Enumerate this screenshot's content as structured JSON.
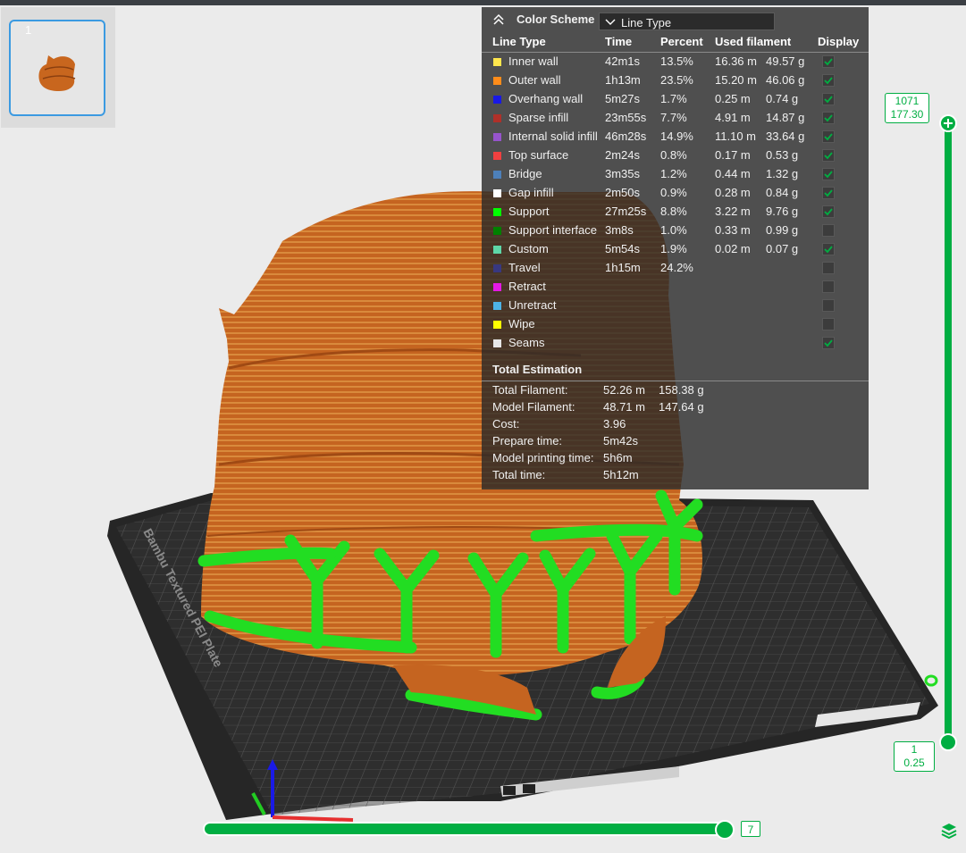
{
  "plate": {
    "number": "1"
  },
  "legend": {
    "collapse_icon": "chevron-up-double-icon",
    "title": "Color Scheme",
    "scheme_value": "Line Type",
    "columns": [
      "Line Type",
      "Time",
      "Percent",
      "Used filament",
      "Display"
    ],
    "rows": [
      {
        "name": "Inner wall",
        "color": "#ffe64d",
        "time": "42m1s",
        "percent": "13.5%",
        "meters": "16.36 m",
        "grams": "49.57 g",
        "display": true
      },
      {
        "name": "Outer wall",
        "color": "#ff8c1a",
        "time": "1h13m",
        "percent": "23.5%",
        "meters": "15.20 m",
        "grams": "46.06 g",
        "display": true
      },
      {
        "name": "Overhang wall",
        "color": "#1919e6",
        "time": "5m27s",
        "percent": "1.7%",
        "meters": "0.25 m",
        "grams": "0.74 g",
        "display": true
      },
      {
        "name": "Sparse infill",
        "color": "#b03029",
        "time": "23m55s",
        "percent": "7.7%",
        "meters": "4.91 m",
        "grams": "14.87 g",
        "display": true
      },
      {
        "name": "Internal solid infill",
        "color": "#9654cc",
        "time": "46m28s",
        "percent": "14.9%",
        "meters": "11.10 m",
        "grams": "33.64 g",
        "display": true
      },
      {
        "name": "Top surface",
        "color": "#f04040",
        "time": "2m24s",
        "percent": "0.8%",
        "meters": "0.17 m",
        "grams": "0.53 g",
        "display": true
      },
      {
        "name": "Bridge",
        "color": "#4d80ba",
        "time": "3m35s",
        "percent": "1.2%",
        "meters": "0.44 m",
        "grams": "1.32 g",
        "display": true
      },
      {
        "name": "Gap infill",
        "color": "#ffffff",
        "time": "2m50s",
        "percent": "0.9%",
        "meters": "0.28 m",
        "grams": "0.84 g",
        "display": true
      },
      {
        "name": "Support",
        "color": "#00ff00",
        "time": "27m25s",
        "percent": "8.8%",
        "meters": "3.22 m",
        "grams": "9.76 g",
        "display": true
      },
      {
        "name": "Support interface",
        "color": "#008000",
        "time": "3m8s",
        "percent": "1.0%",
        "meters": "0.33 m",
        "grams": "0.99 g",
        "display": false
      },
      {
        "name": "Custom",
        "color": "#5ed7a8",
        "time": "5m54s",
        "percent": "1.9%",
        "meters": "0.02 m",
        "grams": "0.07 g",
        "display": true
      },
      {
        "name": "Travel",
        "color": "#383880",
        "time": "1h15m",
        "percent": "24.2%",
        "meters": "",
        "grams": "",
        "display": false
      },
      {
        "name": "Retract",
        "color": "#e619e6",
        "time": "",
        "percent": "",
        "meters": "",
        "grams": "",
        "display": false
      },
      {
        "name": "Unretract",
        "color": "#4db3e6",
        "time": "",
        "percent": "",
        "meters": "",
        "grams": "",
        "display": false
      },
      {
        "name": "Wipe",
        "color": "#ffff00",
        "time": "",
        "percent": "",
        "meters": "",
        "grams": "",
        "display": false
      },
      {
        "name": "Seams",
        "color": "#e6e6e6",
        "time": "",
        "percent": "",
        "meters": "",
        "grams": "",
        "display": true
      }
    ],
    "total_title": "Total Estimation",
    "totals": [
      {
        "label": "Total Filament:",
        "v1": "52.26 m",
        "v2": "158.38 g"
      },
      {
        "label": "Model Filament:",
        "v1": "48.71 m",
        "v2": "147.64 g"
      },
      {
        "label": "Cost:",
        "v1": "3.96",
        "v2": ""
      },
      {
        "label": "Prepare time:",
        "v1": "5m42s",
        "v2": ""
      },
      {
        "label": "Model printing time:",
        "v1": "5h6m",
        "v2": ""
      },
      {
        "label": "Total time:",
        "v1": "5h12m",
        "v2": ""
      }
    ]
  },
  "plate_label": "Bambu Textured PEI Plate",
  "vslider": {
    "top_layer": "1071",
    "top_height": "177.30",
    "bottom_layer": "1",
    "bottom_height": "0.25",
    "top_icon": "plus-icon"
  },
  "hslider": {
    "value": "7"
  },
  "layers_icon": "layers-icon",
  "colors": {
    "accent": "#00ae42",
    "model": "#c8661e",
    "support": "#22dd22",
    "bed": "#3a3a3a"
  }
}
